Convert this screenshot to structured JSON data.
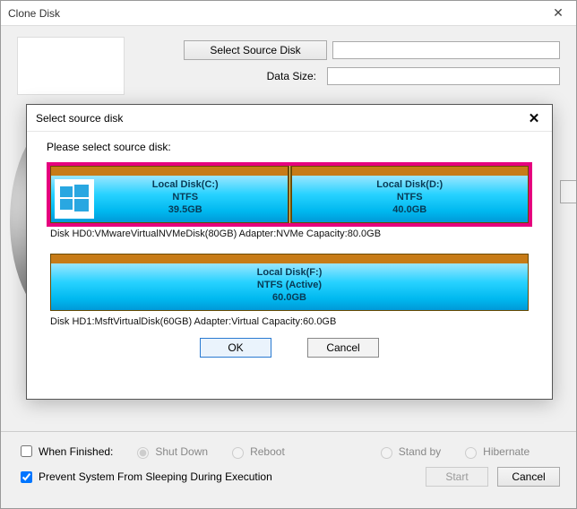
{
  "window": {
    "title": "Clone Disk",
    "select_source_btn": "Select Source Disk",
    "data_size_label": "Data Size:"
  },
  "bottom": {
    "when_finished_label": "When Finished:",
    "shut_down": "Shut Down",
    "reboot": "Reboot",
    "stand_by": "Stand by",
    "hibernate": "Hibernate",
    "prevent_sleep": "Prevent System From Sleeping During Execution",
    "start": "Start",
    "cancel": "Cancel"
  },
  "modal": {
    "title": "Select source disk",
    "instruction": "Please select source disk:",
    "ok": "OK",
    "cancel": "Cancel",
    "disks": [
      {
        "meta": "Disk HD0:VMwareVirtualNVMeDisk(80GB)  Adapter:NVMe  Capacity:80.0GB",
        "selected": true,
        "partitions": [
          {
            "name": "Local Disk(C:)",
            "fs": "NTFS",
            "size": "39.5GB",
            "has_win_icon": true
          },
          {
            "name": "Local Disk(D:)",
            "fs": "NTFS",
            "size": "40.0GB",
            "has_win_icon": false
          }
        ]
      },
      {
        "meta": "Disk HD1:MsftVirtualDisk(60GB)  Adapter:Virtual  Capacity:60.0GB",
        "selected": false,
        "partitions": [
          {
            "name": "Local Disk(F:)",
            "fs": "NTFS (Active)",
            "size": "60.0GB",
            "has_win_icon": false
          }
        ]
      }
    ]
  }
}
